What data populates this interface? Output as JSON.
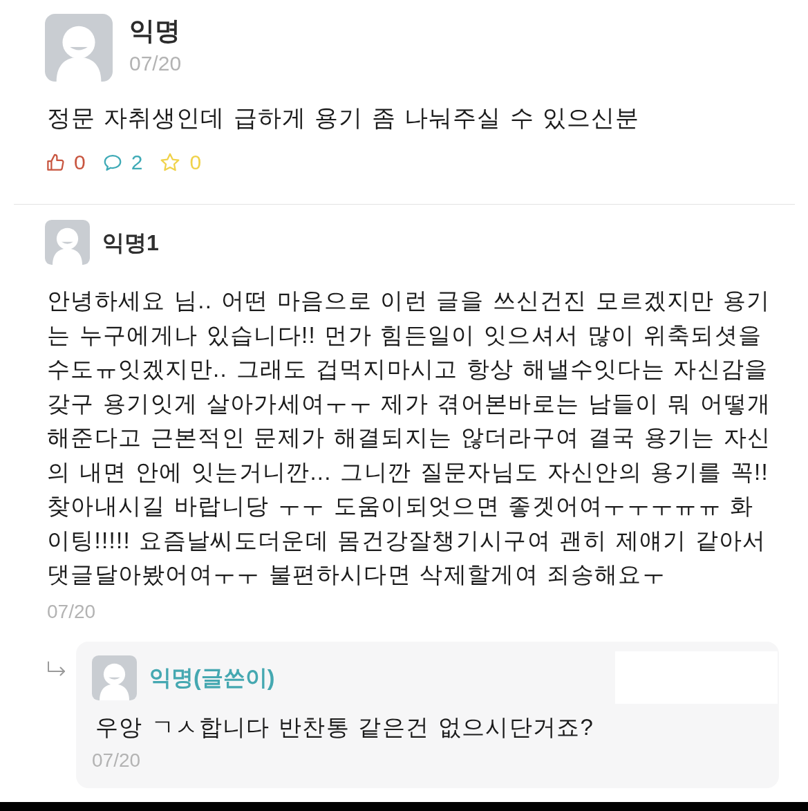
{
  "post": {
    "author": "익명",
    "date": "07/20",
    "title": "정문 자취생인데 급하게 용기 좀 나눠주실 수 있으신분",
    "stats": [
      {
        "kind": "like",
        "count": "0",
        "color": "#c8553f"
      },
      {
        "kind": "comment",
        "count": "2",
        "color": "#3eaab6"
      },
      {
        "kind": "scrap",
        "count": "0",
        "color": "#f0d24a"
      }
    ]
  },
  "comments": [
    {
      "author": "익명1",
      "is_writer": false,
      "body": "안녕하세요 님.. 어떤 마음으로 이런 글을 쓰신건진 모르겠지만 용기는 누구에게나 있습니다!! 먼가 힘든일이 잇으셔서 많이 위축되셧을 수도ㅠ잇겠지만.. 그래도 겁먹지마시고 항상 해낼수잇다는 자신감을 갖구 용기잇게 살아가세여ㅜㅜ 제가 겪어본바로는 남들이 뭐 어떻개해준다고 근본적인 문제가 해결되지는 않더라구여 결국 용기는 자신의 내면 안에 잇는거니깐... 그니깐 질문자님도 자신안의 용기를 꼭!! 찾아내시길 바랍니당 ㅜㅜ 도움이되엇으면 좋겟어여ㅜㅜㅜㅠㅠ 화이팅!!!!! 요즘날씨도더운데 몸건강잘챙기시구여 괜히 제얘기 같아서 댓글달아봤어여ㅜㅜ 불편하시다면 삭제할게여 죄송해요ㅜ",
      "date": "07/20",
      "replies": [
        {
          "author": "익명(글쓴이)",
          "is_writer": true,
          "body": "우앙 ㄱㅅ합니다 반찬통 같은건 없으시단거죠?",
          "date": "07/20"
        }
      ]
    }
  ]
}
